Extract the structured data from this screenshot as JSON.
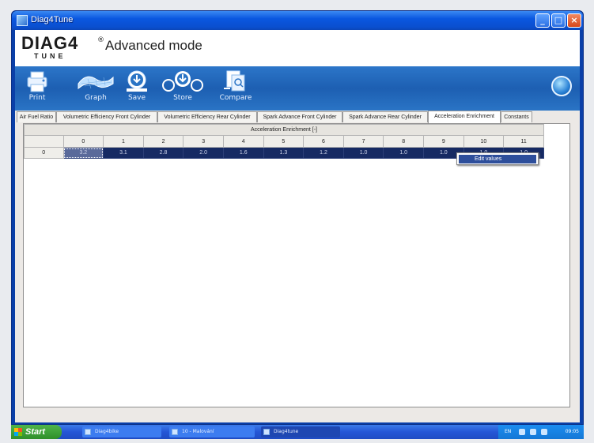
{
  "window": {
    "title": "Diag4Tune"
  },
  "brand": {
    "logo_main": "DIAG",
    "logo_digit": "4",
    "logo_sub": "TUNE",
    "logo_reg": "®",
    "mode_title": "Advanced mode"
  },
  "toolbar": {
    "print": "Print",
    "graph": "Graph",
    "save": "Save",
    "store": "Store",
    "compare": "Compare"
  },
  "tabs": [
    "Air Fuel Ratio",
    "Volumetric Efficiency Front Cylinder",
    "Volumetric Efficiency Rear Cylinder",
    "Spark Advance Front Cylinder",
    "Spark Advance Rear Cylinder",
    "Acceleration Enrichment",
    "Constants"
  ],
  "active_tab": "Acceleration Enrichment",
  "table": {
    "caption": "Acceleration Enrichment [-]",
    "columns": [
      "0",
      "1",
      "2",
      "3",
      "4",
      "5",
      "6",
      "7",
      "8",
      "9",
      "10",
      "11"
    ],
    "rows": [
      {
        "label": "0",
        "values": [
          "3.2",
          "3.1",
          "2.8",
          "2.0",
          "1.6",
          "1.3",
          "1.2",
          "1.0",
          "1.0",
          "1.0",
          "1.0",
          "1.0"
        ]
      }
    ],
    "selected_cell": "3.2"
  },
  "context_menu": {
    "edit_values": "Edit values"
  },
  "taskbar": {
    "start": "Start",
    "tasks": [
      "Diag4bike",
      "10 - Malování",
      "Diag4tune"
    ],
    "active_task": "Diag4tune",
    "language": "EN",
    "clock": "09:05"
  },
  "colors": {
    "titlebar": "#0a57e0",
    "toolbar": "#1d5fb2",
    "cell_fill": "#162a63",
    "context_highlight": "#2d4e9b"
  }
}
